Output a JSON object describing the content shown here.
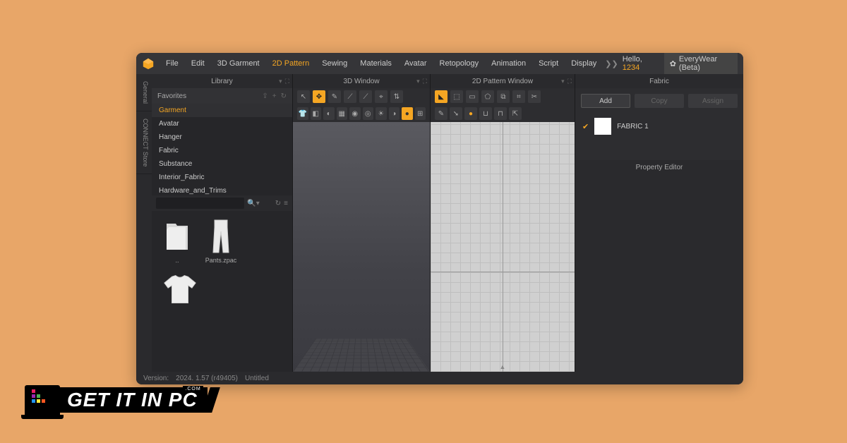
{
  "menu": {
    "items": [
      "File",
      "Edit",
      "3D Garment",
      "2D Pattern",
      "Sewing",
      "Materials",
      "Avatar",
      "Retopology",
      "Animation",
      "Script",
      "Display"
    ],
    "active_index": 3,
    "hello_prefix": "Hello, ",
    "hello_user": "1234",
    "everywear": "EveryWear (Beta)"
  },
  "side_tabs": [
    "General",
    "CONNECT Store"
  ],
  "library": {
    "title": "Library",
    "favorites_label": "Favorites",
    "categories": [
      "Garment",
      "Avatar",
      "Hanger",
      "Fabric",
      "Substance",
      "Interior_Fabric",
      "Hardware_and_Trims"
    ],
    "selected_index": 0,
    "thumbs": [
      {
        "label": ".."
      },
      {
        "label": "Pants.zpac"
      },
      {
        "label": ""
      }
    ]
  },
  "viewport3d": {
    "title": "3D Window"
  },
  "viewport2d": {
    "title": "2D Pattern Window"
  },
  "fabric": {
    "title": "Fabric",
    "buttons": {
      "add": "Add",
      "copy": "Copy",
      "assign": "Assign"
    },
    "items": [
      {
        "name": "FABRIC 1"
      }
    ]
  },
  "property_editor": {
    "title": "Property Editor"
  },
  "status": {
    "version_label": "Version:",
    "version": "2024. 1.57 (r49405)",
    "file": "Untitled"
  },
  "badge": {
    "text": "GET IT IN PC",
    "com": ".COM"
  }
}
